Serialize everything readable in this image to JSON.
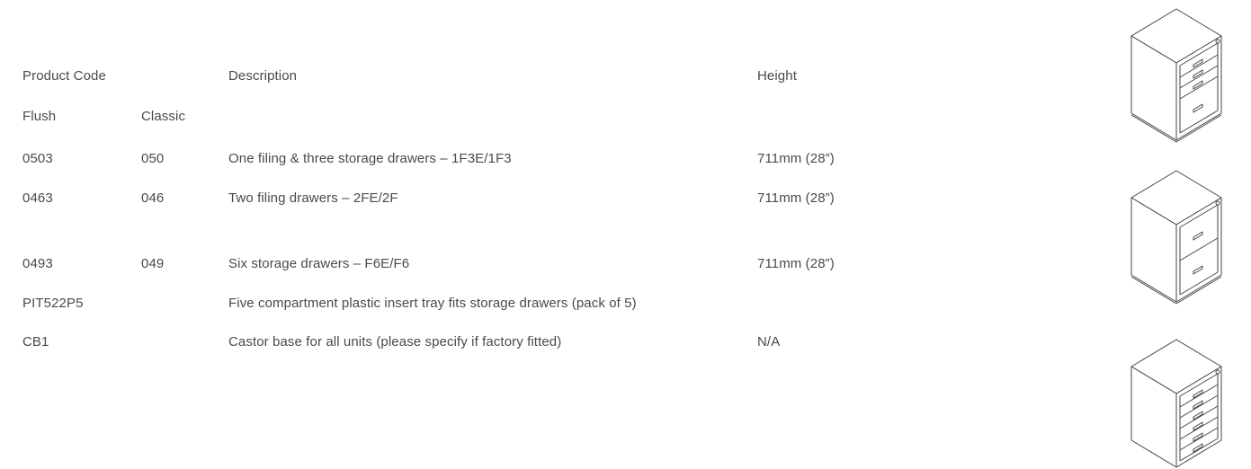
{
  "header": {
    "product_code": "Product Code",
    "description": "Description",
    "height": "Height",
    "flush": "Flush",
    "classic": "Classic"
  },
  "rows": [
    {
      "flush": "0503",
      "classic": "050",
      "description": "One filing & three storage drawers – 1F3E/1F3",
      "height": "711mm (28”)"
    },
    {
      "flush": "0463",
      "classic": "046",
      "description": "Two filing drawers – 2FE/2F",
      "height": "711mm (28”)"
    },
    {
      "flush": "0493",
      "classic": "049",
      "description": "Six storage drawers – F6E/F6",
      "height": "711mm (28”)"
    },
    {
      "flush": "PIT522P5",
      "classic": "",
      "description": "Five compartment plastic insert tray fits storage drawers (pack of 5)",
      "height": ""
    },
    {
      "flush": "CB1",
      "classic": "",
      "description": "Castor base for all units (please specify if factory fitted)",
      "height": "N/A"
    }
  ],
  "illustrations": [
    {
      "icon": "cabinet-one-filing-three-storage-icon"
    },
    {
      "icon": "cabinet-two-filing-icon"
    },
    {
      "icon": "cabinet-six-storage-icon"
    }
  ]
}
